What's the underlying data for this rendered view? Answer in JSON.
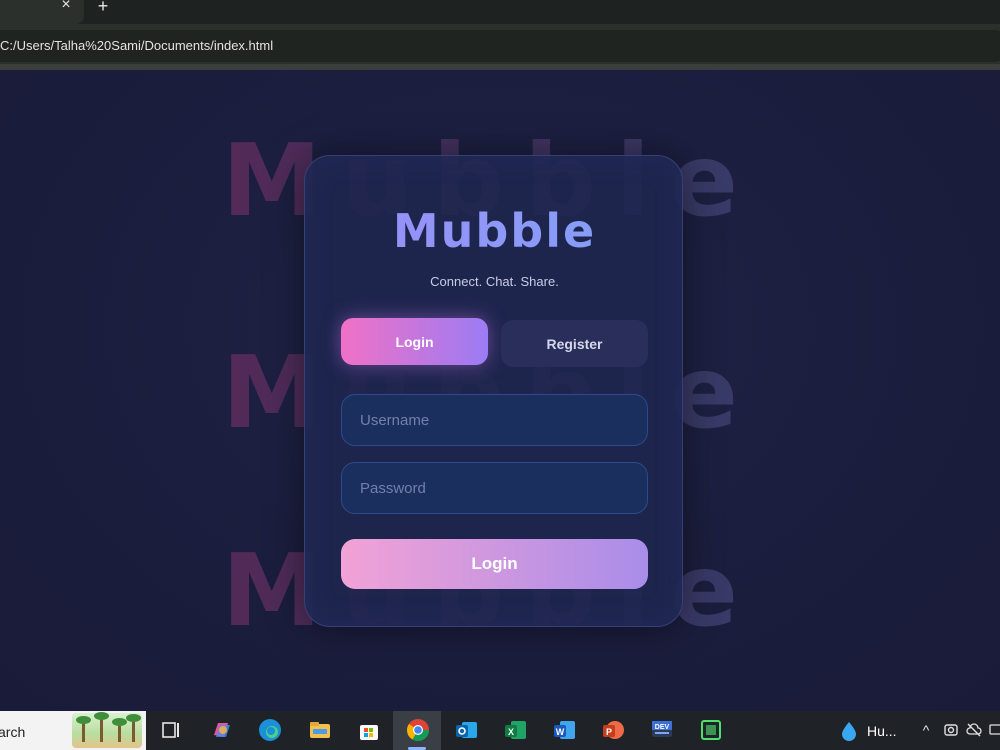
{
  "browser": {
    "tab_close": "×",
    "new_tab": "+",
    "address": "C:/Users/Talha%20Sami/Documents/index.html"
  },
  "page": {
    "background_word": "Mubble",
    "brand": "Mubble",
    "tagline": "Connect. Chat. Share.",
    "tabs": {
      "login": "Login",
      "register": "Register"
    },
    "username_placeholder": "Username",
    "password_placeholder": "Password",
    "submit": "Login",
    "colors": {
      "accent_pink": "#f071c6",
      "accent_purple": "#9b7cf4",
      "card": "#1e264e"
    }
  },
  "taskbar": {
    "search_text": "arch",
    "weather_text": "Hu...",
    "icons": [
      "task-view-icon",
      "copilot-icon",
      "edge-icon",
      "file-explorer-icon",
      "store-icon",
      "chrome-icon",
      "outlook-icon",
      "excel-icon",
      "word-icon",
      "powerpoint-icon",
      "devhome-icon",
      "terminal-icon"
    ],
    "tray": {
      "chevron": "^"
    }
  }
}
